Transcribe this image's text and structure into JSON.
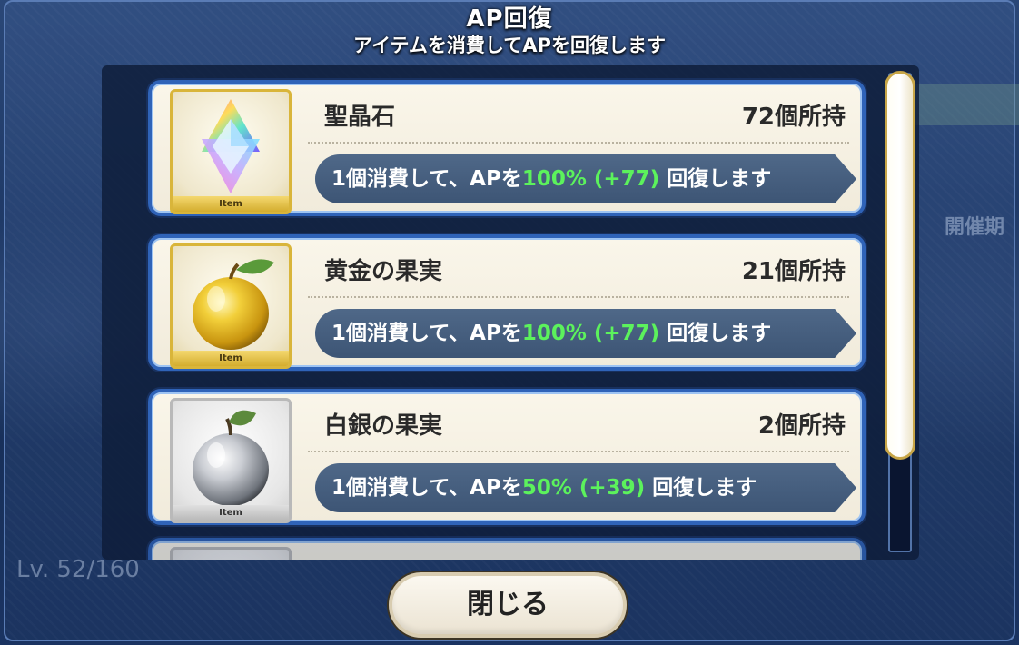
{
  "dialog": {
    "title": "AP回復",
    "subtitle": "アイテムを消費してAPを回復します"
  },
  "items": [
    {
      "name": "聖晶石",
      "count": "72個所持",
      "text_prefix": "1個消費して、APを",
      "highlight": "100% (+77)",
      "text_suffix": " 回復します",
      "thumb_label": "Item",
      "frame": "gold",
      "icon": "saint-quartz-icon"
    },
    {
      "name": "黄金の果実",
      "count": "21個所持",
      "text_prefix": "1個消費して、APを",
      "highlight": "100% (+77)",
      "text_suffix": " 回復します",
      "thumb_label": "Item",
      "frame": "gold",
      "icon": "golden-apple-icon"
    },
    {
      "name": "白銀の果実",
      "count": "2個所持",
      "text_prefix": "1個消費して、APを",
      "highlight": "50% (+39)",
      "text_suffix": " 回復します",
      "thumb_label": "Item",
      "frame": "silver",
      "icon": "silver-apple-icon"
    }
  ],
  "close_button": {
    "label": "閉じる"
  },
  "background": {
    "level_text": "Lv. 52/160",
    "right_label": "開催期"
  },
  "colors": {
    "highlight_green": "#5cf25c",
    "card_border": "#2f63b8",
    "info_pill": "#4f6888"
  }
}
